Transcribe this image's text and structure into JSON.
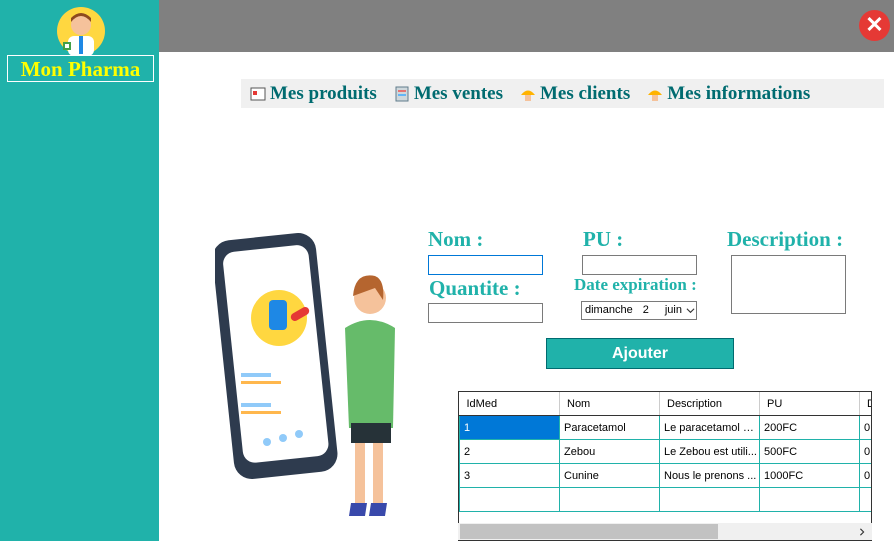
{
  "sidebar": {
    "brand": "Mon Pharma"
  },
  "window": {
    "close_glyph": "✕"
  },
  "menu": [
    {
      "label": "Mes produits",
      "icon": "products-icon"
    },
    {
      "label": "Mes ventes",
      "icon": "sales-icon"
    },
    {
      "label": "Mes clients",
      "icon": "clients-icon"
    },
    {
      "label": "Mes informations",
      "icon": "info-icon"
    }
  ],
  "form": {
    "nom_label": "Nom :",
    "pu_label": "PU :",
    "description_label": "Description :",
    "quantite_label": "Quantite :",
    "date_label": "Date expiration :",
    "date_day": "dimanche",
    "date_num": "2",
    "date_month": "juin",
    "ajouter_label": "Ajouter"
  },
  "table": {
    "headers": [
      "IdMed",
      "Nom",
      "Description",
      "PU",
      "D"
    ],
    "rows": [
      [
        "1",
        "Paracetamol",
        "Le paracetamol e...",
        "200FC",
        "0"
      ],
      [
        "2",
        "Zebou",
        "Le Zebou est utili...",
        "500FC",
        "0"
      ],
      [
        "3",
        "Cunine",
        "Nous le prenons ...",
        "1000FC",
        "0"
      ]
    ]
  },
  "colors": {
    "sidebar": "#20b2aa",
    "topbar": "#808080",
    "brand_text": "#ffff00",
    "accent": "#20b2aa",
    "menu_text": "#006b70"
  }
}
